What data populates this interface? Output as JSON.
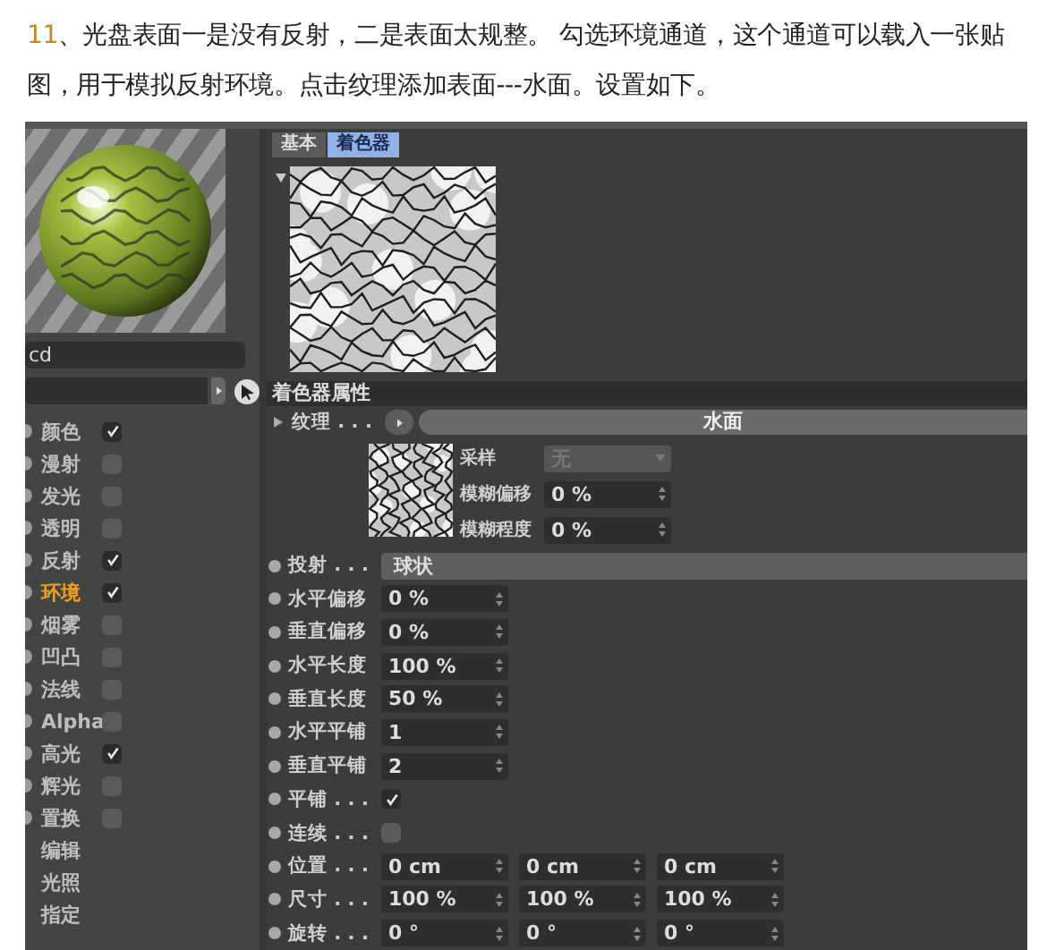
{
  "article": {
    "number": "11",
    "text": "、光盘表面一是没有反射，二是表面太规整。 勾选环境通道，这个通道可以载入一张贴图，用于模拟反射环境。点击纹理添加表面---水面。设置如下。"
  },
  "material_editor": {
    "name_field": "cd",
    "channels": [
      {
        "kind": "channel",
        "label": "颜色",
        "checked": true,
        "selected": false
      },
      {
        "kind": "channel",
        "label": "漫射",
        "checked": false,
        "selected": false
      },
      {
        "kind": "channel",
        "label": "发光",
        "checked": false,
        "selected": false
      },
      {
        "kind": "channel",
        "label": "透明",
        "checked": false,
        "selected": false
      },
      {
        "kind": "channel",
        "label": "反射",
        "checked": true,
        "selected": false
      },
      {
        "kind": "channel",
        "label": "环境",
        "checked": true,
        "selected": true
      },
      {
        "kind": "channel",
        "label": "烟雾",
        "checked": false,
        "selected": false
      },
      {
        "kind": "channel",
        "label": "凹凸",
        "checked": false,
        "selected": false
      },
      {
        "kind": "channel",
        "label": "法线",
        "checked": false,
        "selected": false
      },
      {
        "kind": "channel",
        "label": "Alpha",
        "checked": false,
        "selected": false
      },
      {
        "kind": "channel",
        "label": "高光",
        "checked": true,
        "selected": false
      },
      {
        "kind": "channel",
        "label": "辉光",
        "checked": false,
        "selected": false
      },
      {
        "kind": "channel",
        "label": "置换",
        "checked": false,
        "selected": false
      },
      {
        "kind": "page",
        "label": "编辑",
        "selected": false
      },
      {
        "kind": "page",
        "label": "光照",
        "selected": false
      },
      {
        "kind": "page",
        "label": "指定",
        "selected": false
      }
    ],
    "tabs": [
      {
        "label": "基本",
        "selected": false
      },
      {
        "label": "着色器",
        "selected": true
      }
    ],
    "section_title": "着色器属性",
    "texture": {
      "label": "纹理 . . .",
      "value": "水面"
    },
    "sampling": [
      {
        "kind": "dropdown",
        "label": "采样",
        "value": "无",
        "disabled": true
      },
      {
        "kind": "field",
        "label": "模糊偏移",
        "value": "0 %"
      },
      {
        "kind": "field",
        "label": "模糊程度",
        "value": "0 %"
      }
    ],
    "params": [
      {
        "kind": "bar",
        "label": "投射 . . .",
        "value": "球状"
      },
      {
        "kind": "fields",
        "label": "水平偏移",
        "values": [
          "0 %"
        ]
      },
      {
        "kind": "fields",
        "label": "垂直偏移",
        "values": [
          "0 %"
        ]
      },
      {
        "kind": "fields",
        "label": "水平长度",
        "values": [
          "100 %"
        ]
      },
      {
        "kind": "fields",
        "label": "垂直长度",
        "values": [
          "50 %"
        ]
      },
      {
        "kind": "fields",
        "label": "水平平铺",
        "values": [
          "1"
        ]
      },
      {
        "kind": "fields",
        "label": "垂直平铺",
        "values": [
          "2"
        ]
      },
      {
        "kind": "checkbox",
        "label": "平铺 . . .",
        "checked": true
      },
      {
        "kind": "checkbox",
        "label": "连续 . . .",
        "checked": false
      },
      {
        "kind": "fields",
        "label": "位置 . . .",
        "values": [
          "0 cm",
          "0 cm",
          "0 cm"
        ]
      },
      {
        "kind": "fields",
        "label": "尺寸 . . .",
        "values": [
          "100 %",
          "100 %",
          "100 %"
        ]
      },
      {
        "kind": "fields",
        "label": "旋转 . . .",
        "values": [
          "0 °",
          "0 °",
          "0 °"
        ]
      }
    ]
  }
}
